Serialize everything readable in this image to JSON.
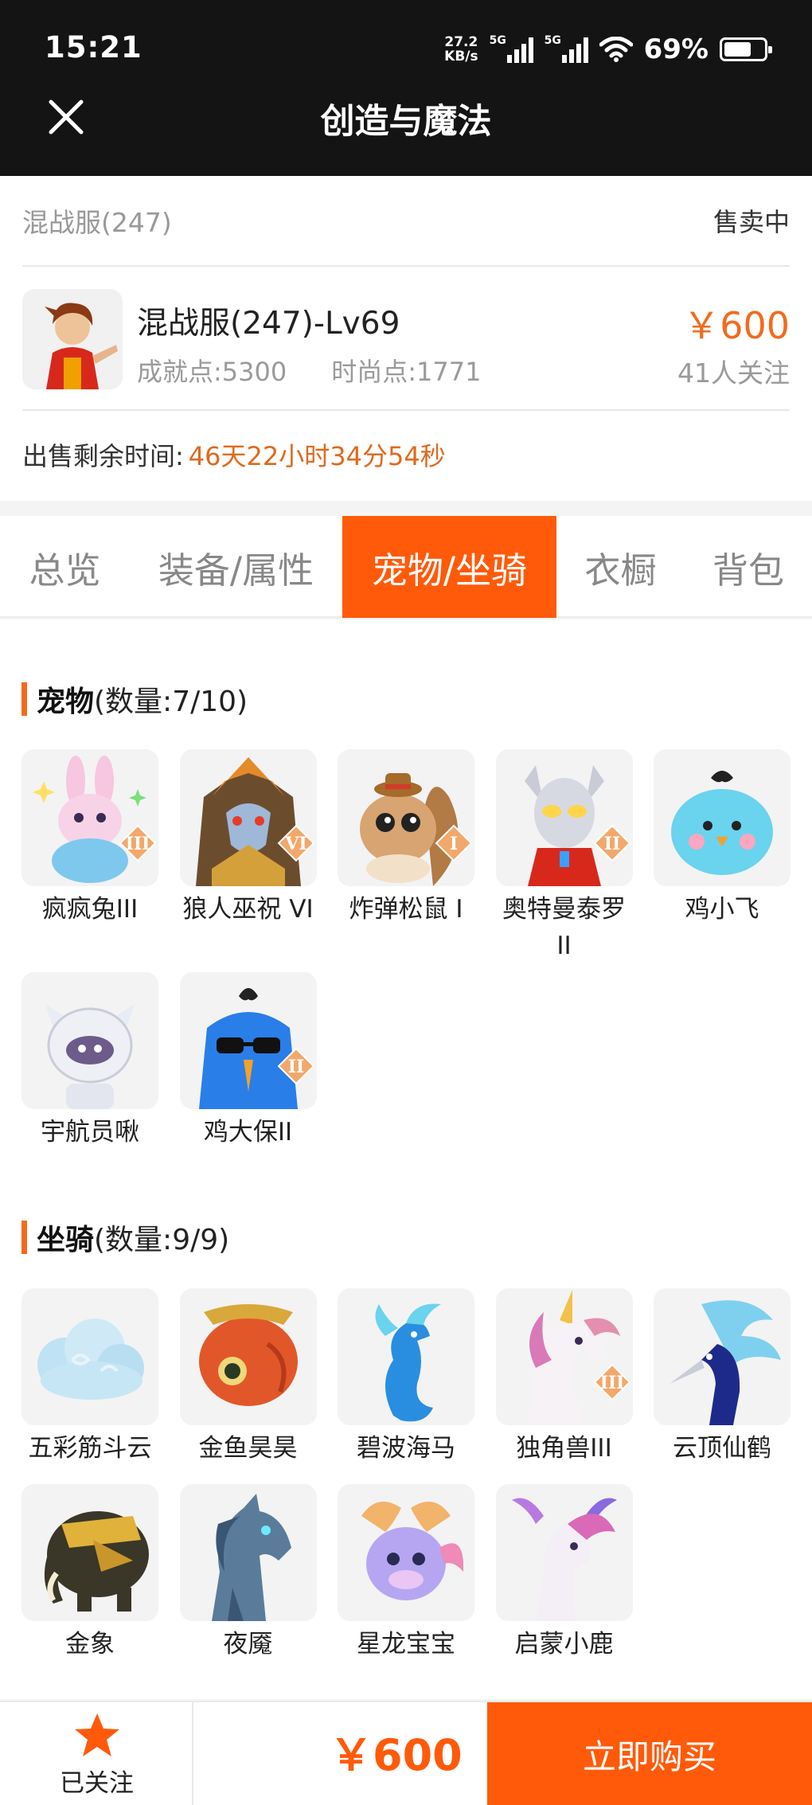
{
  "status_bar": {
    "time": "15:21",
    "net_speed_value": "27.2",
    "net_speed_unit": "KB/s",
    "signal_1_label": "5G",
    "signal_2_label": "5G",
    "battery_pct": "69%",
    "battery_level": 0.69
  },
  "header": {
    "title": "创造与魔法"
  },
  "listing": {
    "server": "混战服(247)",
    "status": "售卖中",
    "char_name": "混战服(247)-Lv69",
    "achievement": "成就点:5300",
    "fashion": "时尚点:1771",
    "price": "￥600",
    "followers": "41人关注",
    "timer_label": "出售剩余时间:",
    "timer_value": "46天22小时34分54秒"
  },
  "tabs": [
    {
      "label": "总览"
    },
    {
      "label": "装备/属性"
    },
    {
      "label": "宠物/坐骑"
    },
    {
      "label": "衣橱"
    },
    {
      "label": "背包"
    }
  ],
  "pets": {
    "title": "宠物",
    "count": "(数量:7/10)",
    "items": [
      {
        "name": "疯疯兔III",
        "badge": "III",
        "icon": "rabbit-icon"
      },
      {
        "name": "狼人巫祝 VI",
        "badge": "VI",
        "icon": "werewolf-icon"
      },
      {
        "name": "炸弹松鼠 I",
        "badge": "I",
        "icon": "squirrel-icon"
      },
      {
        "name": "奥特曼泰罗II",
        "badge": "II",
        "icon": "ultraman-icon"
      },
      {
        "name": "鸡小飞",
        "badge": "",
        "icon": "chick-icon"
      },
      {
        "name": "宇航员啾",
        "badge": "",
        "icon": "astronaut-icon"
      },
      {
        "name": "鸡大保II",
        "badge": "II",
        "icon": "chicken-icon"
      }
    ]
  },
  "mounts": {
    "title": "坐骑",
    "count": "(数量:9/9)",
    "items": [
      {
        "name": "五彩筋斗云",
        "badge": "",
        "icon": "cloud-icon"
      },
      {
        "name": "金鱼昊昊",
        "badge": "",
        "icon": "goldfish-icon"
      },
      {
        "name": "碧波海马",
        "badge": "",
        "icon": "seahorse-icon"
      },
      {
        "name": "独角兽III",
        "badge": "III",
        "icon": "unicorn-icon"
      },
      {
        "name": "云顶仙鹤",
        "badge": "",
        "icon": "crane-icon"
      },
      {
        "name": "金象",
        "badge": "",
        "icon": "elephant-icon"
      },
      {
        "name": "夜魇",
        "badge": "",
        "icon": "nightmare-horse-icon"
      },
      {
        "name": "星龙宝宝",
        "badge": "",
        "icon": "baby-dragon-icon"
      },
      {
        "name": "启蒙小鹿",
        "badge": "",
        "icon": "deer-icon"
      }
    ]
  },
  "bottom_bar": {
    "follow_label": "已关注",
    "price": "￥600",
    "buy_label": "立即购买"
  },
  "colors": {
    "accent": "#ff5a0a",
    "price": "#f26b1d",
    "topbar": "#141414"
  }
}
